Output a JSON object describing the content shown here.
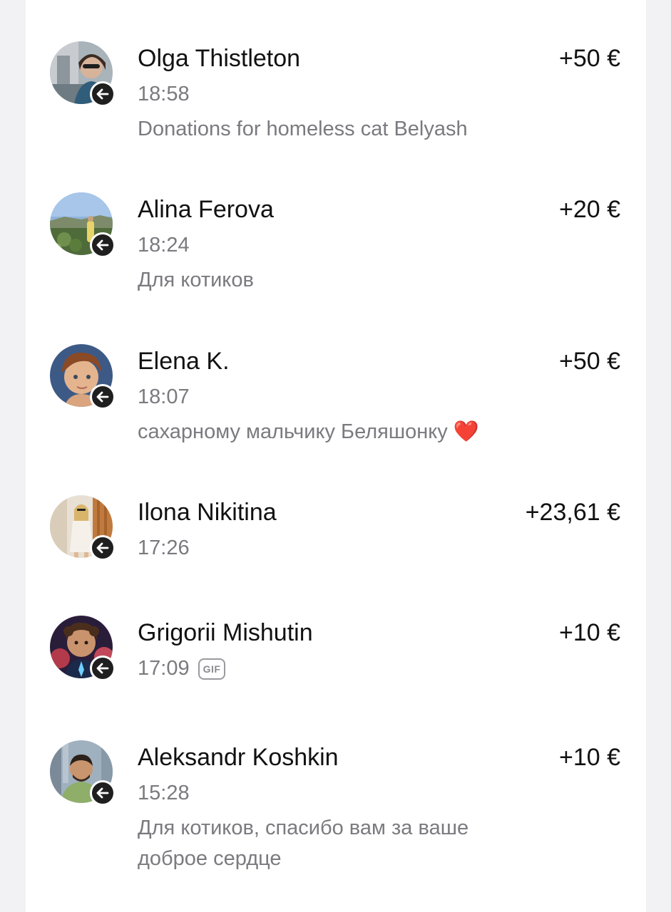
{
  "transactions": [
    {
      "name": "Olga Thistleton",
      "time": "18:58",
      "amount": "+50 €",
      "comment": "Donations for homeless cat Belyash",
      "avatar_icon": "avatar-photo",
      "badge_icon": "arrow-left-icon"
    },
    {
      "name": "Alina Ferova",
      "time": "18:24",
      "amount": "+20 €",
      "comment": "Для котиков",
      "avatar_icon": "avatar-photo",
      "badge_icon": "arrow-left-icon"
    },
    {
      "name": "Elena K.",
      "time": "18:07",
      "amount": "+50 €",
      "comment": "сахарному мальчику Беляшонку",
      "comment_emoji": "❤️",
      "avatar_icon": "avatar-photo",
      "badge_icon": "arrow-left-icon"
    },
    {
      "name": "Ilona Nikitina",
      "time": "17:26",
      "amount": "+23,61 €",
      "avatar_icon": "avatar-photo",
      "badge_icon": "arrow-left-icon"
    },
    {
      "name": "Grigorii Mishutin",
      "time": "17:09",
      "gif_label": "GIF",
      "amount": "+10 €",
      "avatar_icon": "avatar-photo",
      "badge_icon": "arrow-left-icon"
    },
    {
      "name": "Aleksandr Koshkin",
      "time": "15:28",
      "amount": "+10 €",
      "comment": "Для котиков, спасибо вам за ваше доброе сердце",
      "avatar_icon": "avatar-photo",
      "badge_icon": "arrow-left-icon"
    }
  ],
  "colors": {
    "name": "#111111",
    "amount": "#111111",
    "secondary_text": "#7a7a7f",
    "badge_bg": "#1f1f1f",
    "page_bg": "#f2f2f4",
    "card_bg": "#ffffff"
  }
}
